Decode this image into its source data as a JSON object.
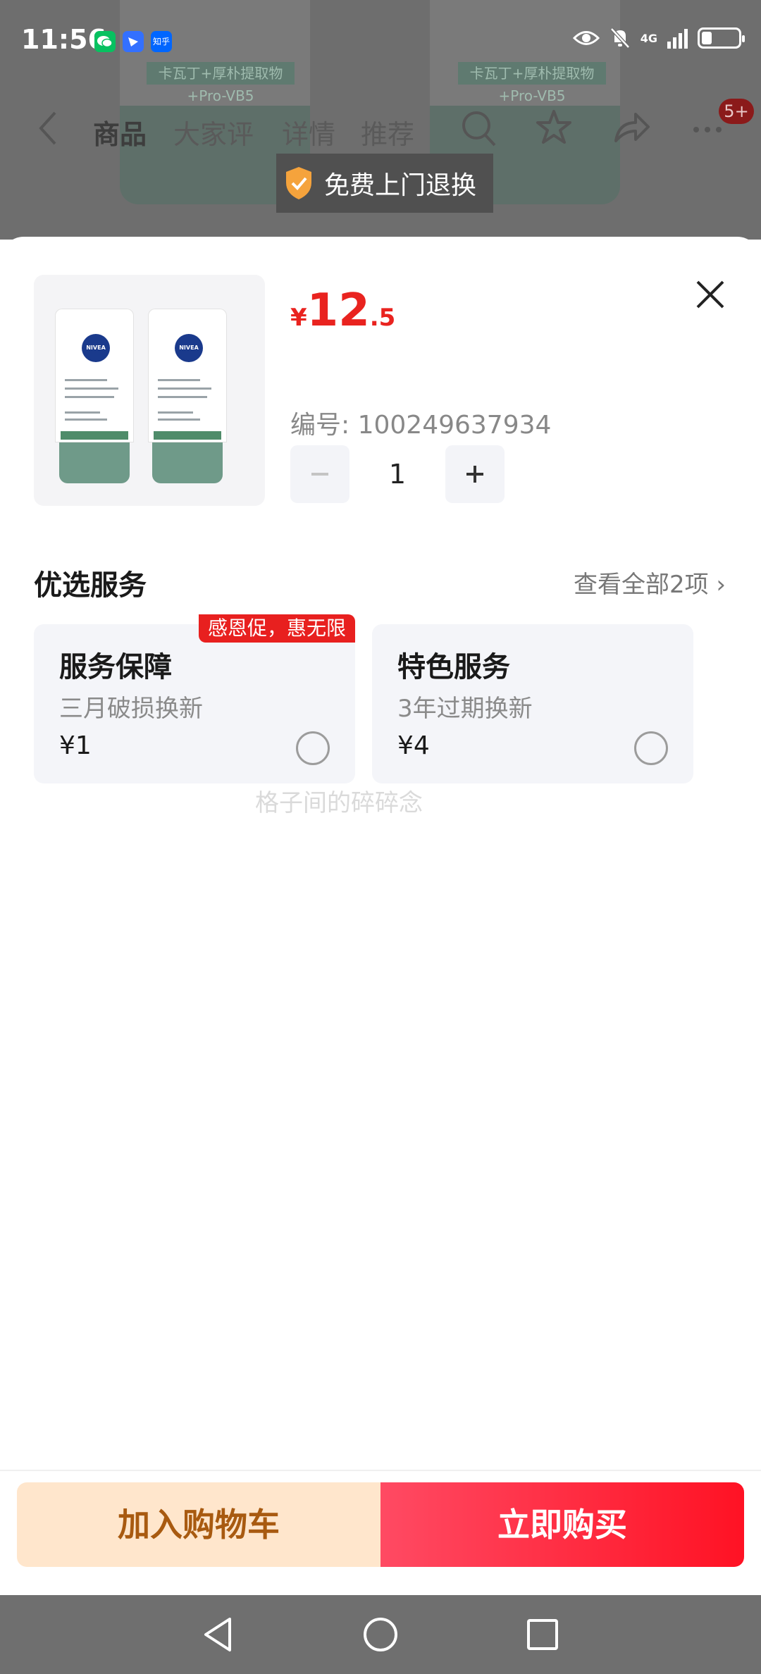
{
  "status_bar": {
    "time": "11:56",
    "apps": [
      {
        "name": "wechat-icon",
        "label": "",
        "color": "#07c160"
      },
      {
        "name": "feishu-icon",
        "label": "",
        "color": "#3370ff"
      },
      {
        "name": "zhihu-icon",
        "label": "知乎",
        "color": "#0066ff"
      }
    ],
    "network": "4G"
  },
  "background": {
    "tabs": [
      "商品",
      "大家评",
      "详情",
      "推荐"
    ],
    "badge": "5+",
    "banner": "免费上门退换",
    "tube_text": "卡瓦丁+厚朴提取物+Pro-VB5"
  },
  "product": {
    "brand": "NIVEA",
    "currency": "¥",
    "price_int": "12",
    "price_dec": ".5",
    "sku_label": "编号: 100249637934",
    "quantity": "1",
    "minus": "−",
    "plus": "+"
  },
  "services": {
    "title": "优选服务",
    "view_all": "查看全部2项 ›",
    "promo_tag": "感恩促，惠无限",
    "cards": [
      {
        "title": "服务保障",
        "subtitle": "三月破损换新",
        "price": "¥1"
      },
      {
        "title": "特色服务",
        "subtitle": "3年过期换新",
        "price": "¥4"
      }
    ]
  },
  "watermark": "格子间的碎碎念",
  "actions": {
    "add_to_cart": "加入购物车",
    "buy_now": "立即购买"
  },
  "colors": {
    "accent": "#e9231f",
    "buy_gradient_start": "#ff4a63",
    "buy_gradient_end": "#ff1224",
    "cart_bg": "#ffe6cc",
    "cart_text": "#a85a10"
  }
}
